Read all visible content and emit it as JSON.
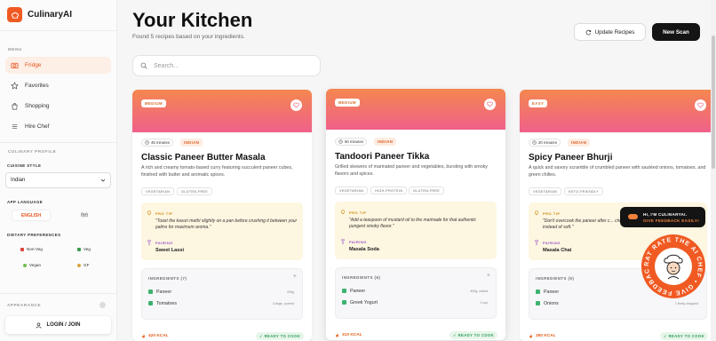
{
  "brand": {
    "name": "CulinaryAI"
  },
  "sidebar": {
    "menu_label": "MENU",
    "nav": [
      {
        "label": "Fridge"
      },
      {
        "label": "Favorites"
      },
      {
        "label": "Shopping"
      },
      {
        "label": "Hire Chef"
      }
    ],
    "profile_label": "CULINARY PROFILE",
    "cuisine_style_label": "CUISINE STYLE",
    "cuisine_style_value": "Indian",
    "app_language_label": "APP LANGUAGE",
    "languages": [
      "ENGLISH",
      "हिंदी"
    ],
    "dietary_label": "DIETARY PREFERENCES",
    "diets": [
      "Non-Veg",
      "Veg",
      "Vegan",
      "GF"
    ],
    "appearance_label": "APPEARANCE",
    "login_label": "LOGIN / JOIN"
  },
  "main": {
    "title": "Your Kitchen",
    "subtitle": "Found 5 recipes based on your ingredients.",
    "update_label": "Update Recipes",
    "new_scan_label": "New Scan",
    "search_placeholder": "Search..."
  },
  "cards": [
    {
      "badge": "MEDIUM",
      "time": "45 minutes",
      "cuisine": "INDIAN",
      "title": "Classic Paneer Butter Masala",
      "desc": "A rich and creamy tomato-based curry featuring succulent paneer cubes, finished with butter and aromatic spices.",
      "tags": [
        "VEGETARIAN",
        "GLUTEN-FREE"
      ],
      "tip_label": "PRO TIP",
      "tip": "\"Toast the kasuri methi slightly on a pan before crushing it between your palms for maximum aroma.\"",
      "pairing_label": "PAIRING",
      "pairing": "Sweet Lassi",
      "ing_head": "INGREDIENTS (7)",
      "ingredients": [
        {
          "name": "Paneer",
          "amt": "200g"
        },
        {
          "name": "Tomatoes",
          "amt": "4 large, pureed"
        }
      ],
      "kcal": "420 KCAL",
      "ready": "READY TO COOK"
    },
    {
      "badge": "MEDIUM",
      "time": "60 minutes",
      "cuisine": "INDIAN",
      "title": "Tandoori Paneer Tikka",
      "desc": "Grilled skewers of marinated paneer and vegetables, bursting with smoky flavors and spices.",
      "tags": [
        "VEGETARIAN",
        "HIGH-PROTEIN",
        "GLUTEN-FREE"
      ],
      "tip_label": "PRO TIP",
      "tip": "\"Add a teaspoon of mustard oil to the marinade for that authentic pungent smoky flavor.\"",
      "pairing_label": "PAIRING",
      "pairing": "Masala Soda",
      "ing_head": "INGREDIENTS (6)",
      "ingredients": [
        {
          "name": "Paneer",
          "amt": "400g, cubed"
        },
        {
          "name": "Greek Yogurt",
          "amt": "1 cup"
        }
      ],
      "kcal": "310 KCAL",
      "ready": "READY TO COOK"
    },
    {
      "badge": "EASY",
      "time": "20 minutes",
      "cuisine": "INDIAN",
      "title": "Spicy Paneer Bhurji",
      "desc": "A quick and savory scramble of crumbled paneer with sautéed onions, tomatoes, and green chilies.",
      "tags": [
        "VEGETARIAN",
        "KETO-FRIENDLY"
      ],
      "tip_label": "PRO TIP",
      "tip": "\"Don't overcook the paneer after c... chewy instead of soft.\"",
      "pairing_label": "PAIRING",
      "pairing": "Masala Chai",
      "ing_head": "INGREDIENTS (5)",
      "ingredients": [
        {
          "name": "Paneer",
          "amt": ""
        },
        {
          "name": "Onions",
          "amt": "1 finely chopped"
        }
      ],
      "kcal": "280 KCAL",
      "ready": "READY TO COOK"
    }
  ],
  "chef": {
    "line1": "HI, I'M CULINARYAI.",
    "line2": "GIVE FEEDBACK EASILY!",
    "ring_text": "RAT RATE THE AI CHEF • GIVE FEEDBACK •"
  },
  "colors": {
    "accent": "#f05a22",
    "dark": "#141414",
    "success": "#3db36f"
  }
}
